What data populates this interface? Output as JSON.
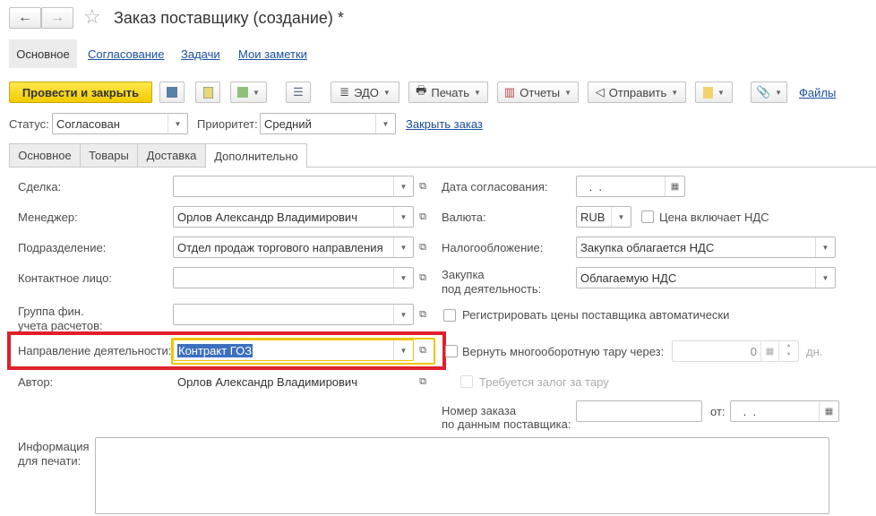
{
  "window": {
    "title": "Заказ поставщику (создание) *",
    "back": "←",
    "forward": "→",
    "star": "☆"
  },
  "nav_tabs": [
    "Основное",
    "Согласование",
    "Задачи",
    "Мои заметки"
  ],
  "toolbar": {
    "post_close": "Провести и закрыть",
    "edo": "ЭДО",
    "print": "Печать",
    "reports": "Отчеты",
    "send": "Отправить",
    "files": "Файлы"
  },
  "status": {
    "label": "Статус:",
    "value": "Согласован",
    "priority_label": "Приоритет:",
    "priority_value": "Средний",
    "close_order": "Закрыть заказ"
  },
  "tabs": [
    "Основное",
    "Товары",
    "Доставка",
    "Дополнительно"
  ],
  "left": {
    "deal_label": "Сделка:",
    "deal": "",
    "manager_label": "Менеджер:",
    "manager": "Орлов Александр Владимирович",
    "division_label": "Подразделение:",
    "division": "Отдел продаж торгового направления",
    "contact_label": "Контактное лицо:",
    "contact": "",
    "fin_group_label1": "Группа фин.",
    "fin_group_label2": "учета расчетов:",
    "fin_group": "",
    "direction_label": "Направление деятельности:",
    "direction": "Контракт ГОЗ",
    "author_label": "Автор:",
    "author": "Орлов Александр Владимирович",
    "print_info_label1": "Информация",
    "print_info_label2": "для печати:"
  },
  "right": {
    "approval_date_label": "Дата согласования:",
    "approval_date": " .  .",
    "currency_label": "Валюта:",
    "currency": "RUB",
    "vat_included": "Цена включает НДС",
    "taxation_label": "Налогообложение:",
    "taxation": "Закупка облагается НДС",
    "purchase_label1": "Закупка",
    "purchase_label2": "под деятельность:",
    "purchase": "Облагаемую НДС",
    "register_prices": "Регистрировать цены поставщика автоматически",
    "return_tare": "Вернуть многооборотную тару через:",
    "return_days": "0",
    "days": "дн.",
    "deposit": "Требуется залог за тару",
    "supplier_order_label1": "Номер заказа",
    "supplier_order_label2": "по данным поставщика:",
    "supplier_order": "",
    "from_label": "от:",
    "from_date": " .  ."
  }
}
